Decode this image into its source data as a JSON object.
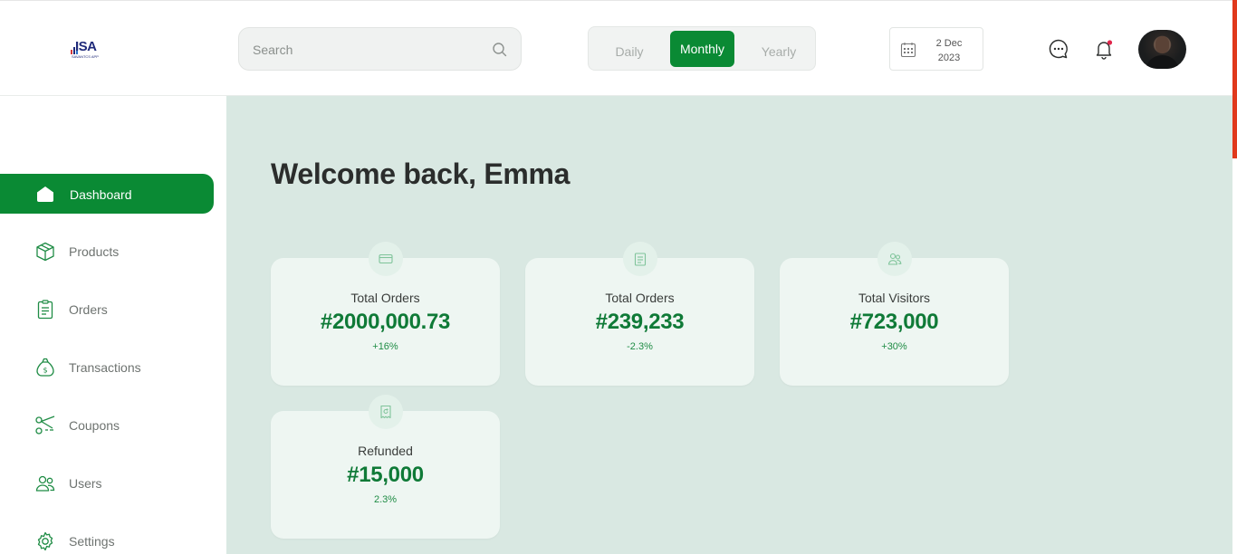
{
  "brand": {
    "logo_text": "ISA",
    "logo_subtext": "SAVANTCS APP"
  },
  "search": {
    "placeholder": "Search"
  },
  "period": {
    "options": [
      "Daily",
      "Monthly",
      "Yearly"
    ],
    "selected": "Monthly"
  },
  "date": {
    "line1": "2 Dec",
    "line2": "2023"
  },
  "header_icons": [
    "message-icon",
    "bell-icon"
  ],
  "sidebar": {
    "items": [
      {
        "label": "Dashboard",
        "icon": "home-icon",
        "active": true
      },
      {
        "label": "Products",
        "icon": "box-icon"
      },
      {
        "label": "Orders",
        "icon": "clipboard-icon"
      },
      {
        "label": "Transactions",
        "icon": "money-bag-icon"
      },
      {
        "label": "Coupons",
        "icon": "scissors-icon"
      },
      {
        "label": "Users",
        "icon": "users-icon"
      },
      {
        "label": "Settings",
        "icon": "gear-icon"
      }
    ]
  },
  "main": {
    "welcome": "Welcome back, Emma",
    "cards": [
      {
        "title": "Total Orders",
        "value": "#2000,000.73",
        "change": "+16%",
        "icon": "card-icon"
      },
      {
        "title": "Total Orders",
        "value": "#239,233",
        "change": "-2.3%",
        "icon": "clipboard-icon"
      },
      {
        "title": "Total Visitors",
        "value": "#723,000",
        "change": "+30%",
        "icon": "users-icon"
      },
      {
        "title": "Refunded",
        "value": "#15,000",
        "change": "2.3%",
        "icon": "receipt-icon"
      }
    ]
  },
  "colors": {
    "primary": "#0a8a34",
    "main_bg": "#d9e8e2",
    "card_bg": "#eef6f2",
    "value_text": "#0f7a37",
    "accent_red": "#e0391c"
  }
}
